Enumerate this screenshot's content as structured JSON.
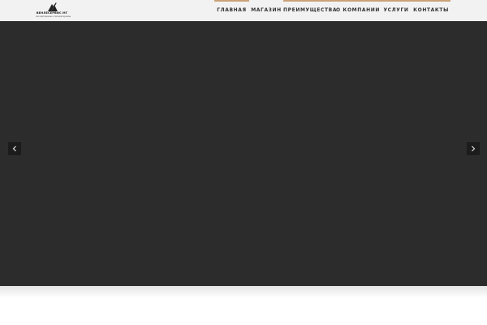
{
  "logo": {
    "title": "ВЕНЛЕСЕРВИС МГ",
    "subtitle": "лесоматериалы и пиломатериалы",
    "icon": "logo-mark-icon",
    "accent": "#222222"
  },
  "nav": {
    "items": [
      {
        "label": "ГЛАВНАЯ",
        "active": true
      },
      {
        "label": "МАГАЗИН",
        "active": false
      },
      {
        "label": "ПРЕИМУЩЕСТВА",
        "active": true
      },
      {
        "label": "О КОМПАНИИ",
        "active": true
      },
      {
        "label": "УСЛУГИ",
        "active": true
      },
      {
        "label": "КОНТАКТЫ",
        "active": true
      }
    ],
    "accent_color": "#c9a27a"
  },
  "slider": {
    "background_color": "#2c2c2c",
    "prev_icon": "chevron-left-icon",
    "next_icon": "chevron-right-icon"
  }
}
